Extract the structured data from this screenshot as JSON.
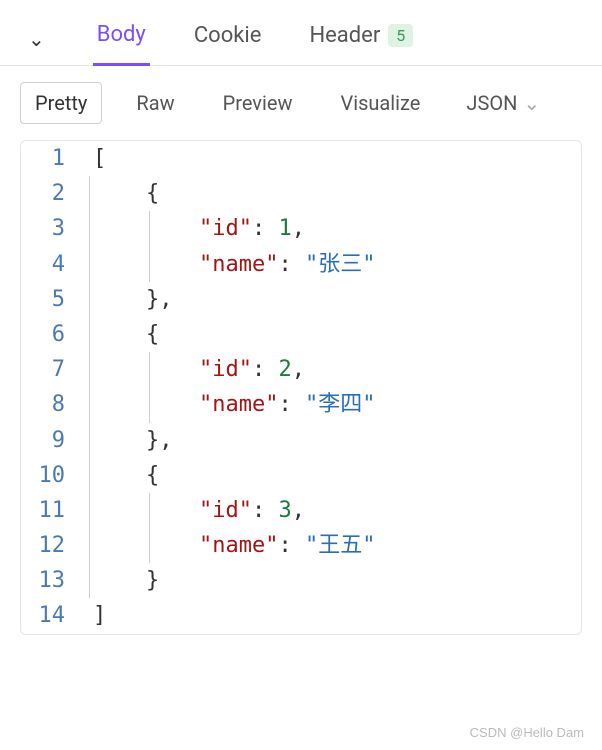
{
  "tabs": {
    "body": "Body",
    "cookie": "Cookie",
    "header": "Header",
    "header_count": "5"
  },
  "subbar": {
    "pretty": "Pretty",
    "raw": "Raw",
    "preview": "Preview",
    "visualize": "Visualize",
    "format": "JSON"
  },
  "code": {
    "lines": [
      {
        "n": "1",
        "ind": 0,
        "g": 0,
        "t": [
          [
            "[",
            "punc"
          ]
        ]
      },
      {
        "n": "2",
        "ind": 1,
        "g": 1,
        "t": [
          [
            "{",
            "punc"
          ]
        ]
      },
      {
        "n": "3",
        "ind": 2,
        "g": 2,
        "t": [
          [
            "\"id\"",
            "key"
          ],
          [
            ":",
            "punc"
          ],
          [
            " ",
            null
          ],
          [
            "1",
            "num"
          ],
          [
            ",",
            "punc"
          ]
        ]
      },
      {
        "n": "4",
        "ind": 2,
        "g": 2,
        "t": [
          [
            "\"name\"",
            "key"
          ],
          [
            ":",
            "punc"
          ],
          [
            " ",
            null
          ],
          [
            "\"张三\"",
            "str"
          ]
        ]
      },
      {
        "n": "5",
        "ind": 1,
        "g": 1,
        "t": [
          [
            "}",
            "punc"
          ],
          [
            ",",
            "punc"
          ]
        ]
      },
      {
        "n": "6",
        "ind": 1,
        "g": 1,
        "t": [
          [
            "{",
            "punc"
          ]
        ]
      },
      {
        "n": "7",
        "ind": 2,
        "g": 2,
        "t": [
          [
            "\"id\"",
            "key"
          ],
          [
            ":",
            "punc"
          ],
          [
            " ",
            null
          ],
          [
            "2",
            "num"
          ],
          [
            ",",
            "punc"
          ]
        ]
      },
      {
        "n": "8",
        "ind": 2,
        "g": 2,
        "t": [
          [
            "\"name\"",
            "key"
          ],
          [
            ":",
            "punc"
          ],
          [
            " ",
            null
          ],
          [
            "\"李四\"",
            "str"
          ]
        ]
      },
      {
        "n": "9",
        "ind": 1,
        "g": 1,
        "t": [
          [
            "}",
            "punc"
          ],
          [
            ",",
            "punc"
          ]
        ]
      },
      {
        "n": "10",
        "ind": 1,
        "g": 1,
        "t": [
          [
            "{",
            "punc"
          ]
        ]
      },
      {
        "n": "11",
        "ind": 2,
        "g": 2,
        "t": [
          [
            "\"id\"",
            "key"
          ],
          [
            ":",
            "punc"
          ],
          [
            " ",
            null
          ],
          [
            "3",
            "num"
          ],
          [
            ",",
            "punc"
          ]
        ]
      },
      {
        "n": "12",
        "ind": 2,
        "g": 2,
        "t": [
          [
            "\"name\"",
            "key"
          ],
          [
            ":",
            "punc"
          ],
          [
            " ",
            null
          ],
          [
            "\"王五\"",
            "str"
          ]
        ]
      },
      {
        "n": "13",
        "ind": 1,
        "g": 1,
        "t": [
          [
            "}",
            "punc"
          ]
        ]
      },
      {
        "n": "14",
        "ind": 0,
        "g": 0,
        "t": [
          [
            "]",
            "punc"
          ]
        ]
      }
    ]
  },
  "watermark": "CSDN @Hello Dam"
}
